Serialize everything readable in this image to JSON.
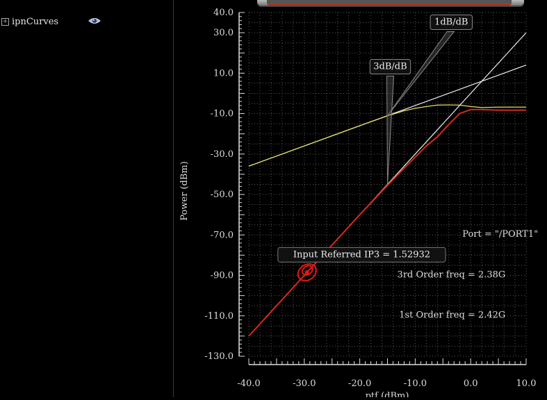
{
  "sidebar": {
    "items": [
      {
        "label": "ipnCurves",
        "expander": "+",
        "icon": "eye-icon"
      }
    ]
  },
  "colors": {
    "background": "#000000",
    "axis": "#dddddd",
    "grid": "#5a5a5a",
    "fundamental_extrap": "#f0f0f0",
    "im3_extrap": "#f0f0f0",
    "fundamental": "#e8e060",
    "im3": "#d42a1e",
    "marker": "#e21a10"
  },
  "chart_data": {
    "type": "line",
    "xlabel": "ptf (dBm)",
    "ylabel": "Power (dBm)",
    "xlim": [
      -40,
      10
    ],
    "ylim": [
      -130,
      40
    ],
    "xticks": [
      -40,
      -30,
      -20,
      -10,
      0,
      10
    ],
    "xtick_labels": [
      "-40.0",
      "-30.0",
      "-20.0",
      "-10.0",
      "0.0",
      "10.0"
    ],
    "yticks": [
      40,
      30,
      10,
      -10,
      -30,
      -50,
      -70,
      -90,
      -110,
      -130
    ],
    "ytick_labels": [
      "40.0",
      "30.0",
      "10.0",
      "-10.0",
      "-30.0",
      "-50.0",
      "-70.0",
      "-90.0",
      "-110.0",
      "-130.0"
    ],
    "grid": true,
    "series": [
      {
        "key": "fund_line",
        "color": "#f0f0f0",
        "x": [
          -40,
          10
        ],
        "y": [
          -36,
          14
        ]
      },
      {
        "key": "im3_line",
        "color": "#f0f0f0",
        "x": [
          -40,
          10
        ],
        "y": [
          -120,
          30
        ]
      },
      {
        "key": "fund_curve",
        "color": "#e8e060",
        "x": [
          -40,
          -30,
          -20,
          -15,
          -12,
          -10,
          -8,
          -6,
          -4,
          -2,
          0,
          2,
          5,
          10
        ],
        "y": [
          -36,
          -26,
          -16,
          -11.1,
          -8.6,
          -7.4,
          -6.5,
          -5.8,
          -5.7,
          -5.8,
          -6.5,
          -7,
          -6.8,
          -6.8
        ]
      },
      {
        "key": "im3_curve",
        "color": "#d42a1e",
        "x": [
          -40,
          -30,
          -20,
          -15,
          -12,
          -10,
          -8,
          -6,
          -4,
          -2,
          0,
          2,
          5,
          10
        ],
        "y": [
          -120,
          -90,
          -60,
          -45.5,
          -37,
          -31.5,
          -26,
          -21.5,
          -15.5,
          -10,
          -8,
          -8,
          -8.3,
          -8.3
        ]
      }
    ],
    "marker": {
      "x": -29.5,
      "y": -88.5
    },
    "annotations": {
      "ip3": {
        "text": "Input Referred IP3 = 1.52932",
        "x": -32,
        "y": -81
      },
      "slope_1db": {
        "text": "1dB/dB",
        "x": -3.5,
        "y": 34,
        "target": {
          "x": -15,
          "y": -11
        }
      },
      "slope_3db": {
        "text": "3dB/dB",
        "x": -14.5,
        "y": 12,
        "target": {
          "x": -15,
          "y": -45
        }
      },
      "port": {
        "text": "Port = \"/PORT1\"",
        "x": -1.5,
        "y": -71
      },
      "order3": {
        "text": "3rd Order freq = 2.38G",
        "x": -2.5,
        "y": -91
      },
      "order1": {
        "text": "1st Order freq = 2.42G",
        "x": -2.5,
        "y": -111
      }
    }
  }
}
